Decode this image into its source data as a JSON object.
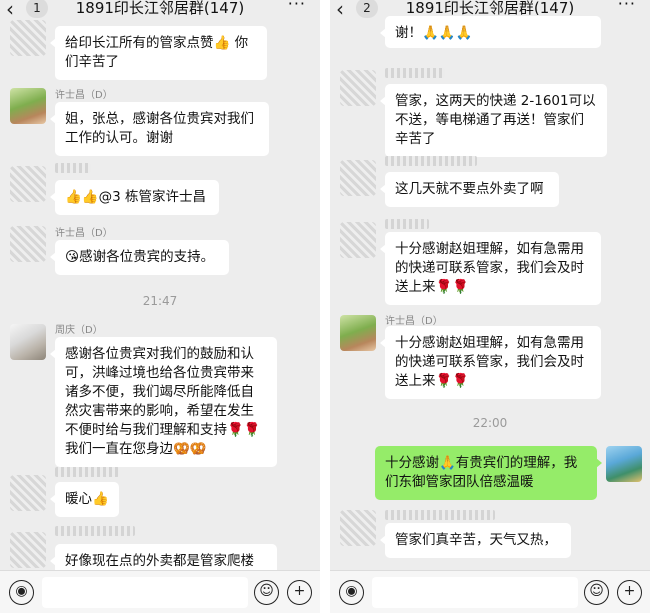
{
  "chat": {
    "title": "1891印长江邻居群(147)",
    "unread_left": "1",
    "unread_right": "2",
    "more": "···"
  },
  "left": {
    "m1": "给印长江所有的管家点赞👍 你们辛苦了",
    "m2_sender": "许士昌（D）",
    "m2": "姐，张总，感谢各位贵宾对我们工作的认可。谢谢",
    "m3": "👍👍@3 栋管家许士昌",
    "m4_sender": "许士昌（D）",
    "m4": "😘感谢各位贵宾的支持。",
    "time": "21:47",
    "m5_sender": "周庆（D）",
    "m5": "感谢各位贵宾对我们的鼓励和认可，洪峰过境也给各位贵宾带来诸多不便，我们竭尽所能降低自然灾害带来的影响，希望在发生不便时给与我们理解和支持🌹🌹我们一直在您身边🥨🥨",
    "m6": "暖心👍",
    "m7": "好像现在点的外卖都是管家爬楼"
  },
  "right": {
    "m1": "谢！🙏🙏🙏",
    "m2": "管家，这两天的快递 2-1601可以不送，等电梯通了再送！管家们辛苦了",
    "m3": "这几天就不要点外卖了啊",
    "m4": "十分感谢赵姐理解，如有急需用的快递可联系管家，我们会及时送上来🌹🌹",
    "m5_sender": "许士昌（D）",
    "m5": "十分感谢赵姐理解，如有急需用的快递可联系管家，我们会及时送上来🌹🌹",
    "time": "22:00",
    "m6": "十分感谢🙏有贵宾们的理解，我们东御管家团队倍感温暖",
    "m7": "管家们真辛苦，天气又热，"
  },
  "icons": {
    "back": "‹",
    "voice": "◉",
    "emoji": "☺",
    "plus": "+"
  }
}
